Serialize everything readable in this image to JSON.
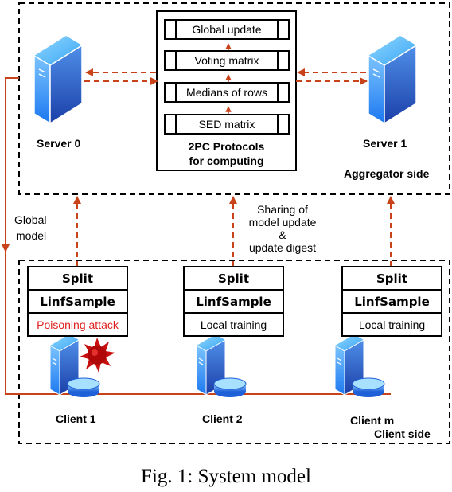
{
  "colors": {
    "arrow": "#c8421a",
    "attack_text": "#e02020",
    "border": "#000000"
  },
  "aggregator": {
    "label": "Aggregator side",
    "server0": {
      "label": "Server 0",
      "icon": "server-icon"
    },
    "server1": {
      "label": "Server 1",
      "icon": "server-icon"
    },
    "protocol": {
      "steps": [
        "Global update",
        "Voting matrix",
        "Medians of rows",
        "SED matrix"
      ],
      "title_line1": "2PC Protocols",
      "title_line2": "for computing"
    }
  },
  "flows": {
    "global_model_line1": "Global",
    "global_model_line2": "model",
    "sharing_line1": "Sharing of",
    "sharing_line2": "model update",
    "sharing_line3": "&",
    "sharing_line4": "update digest"
  },
  "client_side": {
    "label": "Client side",
    "clients": [
      {
        "name": "Client 1",
        "rows": [
          "Split",
          "LinfSample",
          "Poisoning attack"
        ],
        "malicious": true
      },
      {
        "name": "Client 2",
        "rows": [
          "Split",
          "LinfSample",
          "Local training"
        ],
        "malicious": false
      },
      {
        "name": "Client m",
        "rows": [
          "Split",
          "LinfSample",
          "Local training"
        ],
        "malicious": false
      }
    ]
  },
  "caption": "Fig. 1: System model"
}
